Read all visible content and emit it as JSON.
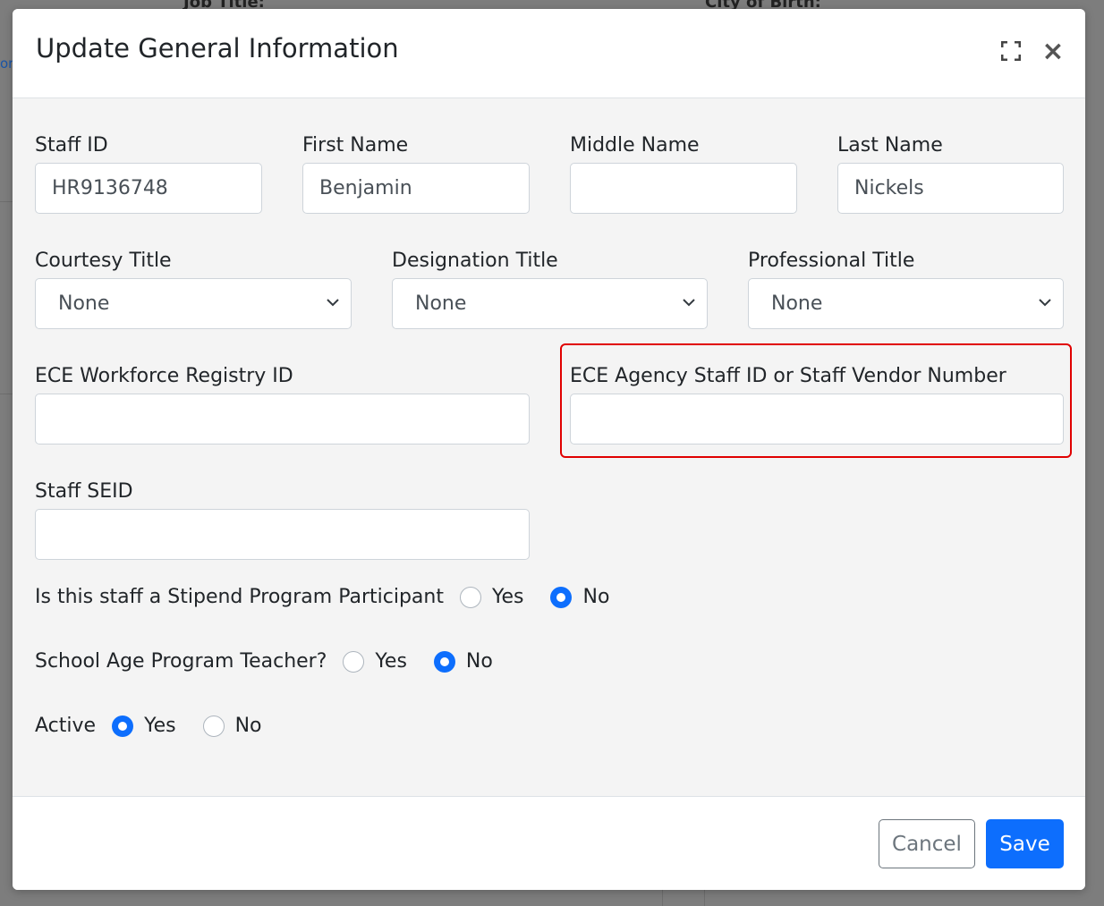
{
  "background": {
    "labels": [
      "Job Title:",
      "City of Birth:"
    ],
    "edge_text": "or"
  },
  "modal": {
    "title": "Update General Information",
    "header_icons": [
      "expand-icon",
      "close-icon"
    ],
    "close_glyph": "×"
  },
  "fields": {
    "staff_id": {
      "label": "Staff ID",
      "value": "HR9136748"
    },
    "first_name": {
      "label": "First Name",
      "value": "Benjamin"
    },
    "middle_name": {
      "label": "Middle Name",
      "value": ""
    },
    "last_name": {
      "label": "Last Name",
      "value": "Nickels"
    },
    "courtesy_title": {
      "label": "Courtesy Title",
      "selected": "None"
    },
    "designation_title": {
      "label": "Designation Title",
      "selected": "None"
    },
    "professional_title": {
      "label": "Professional Title",
      "selected": "None"
    },
    "ece_registry_id": {
      "label": "ECE Workforce Registry ID",
      "value": ""
    },
    "ece_agency_staff_id": {
      "label": "ECE Agency Staff ID or Staff Vendor Number",
      "value": "",
      "highlighted": true
    },
    "staff_seid": {
      "label": "Staff SEID",
      "value": ""
    }
  },
  "radios": {
    "stipend": {
      "question": "Is this staff a Stipend Program Participant",
      "yes": "Yes",
      "no": "No",
      "selected": "No"
    },
    "school_age": {
      "question": "School Age Program Teacher?",
      "yes": "Yes",
      "no": "No",
      "selected": "No"
    },
    "active": {
      "question": "Active",
      "yes": "Yes",
      "no": "No",
      "selected": "Yes"
    }
  },
  "footer": {
    "cancel_label": "Cancel",
    "save_label": "Save"
  },
  "colors": {
    "primary": "#0d6efd",
    "highlight": "#e00000",
    "secondary": "#6c757d"
  }
}
